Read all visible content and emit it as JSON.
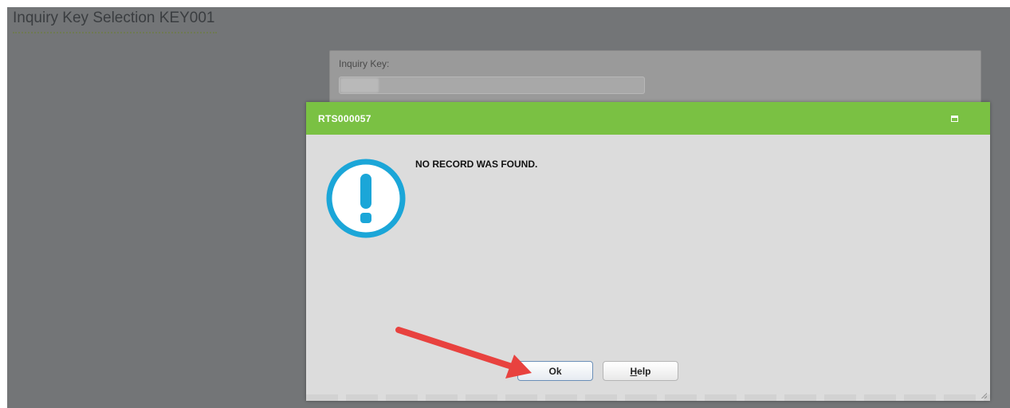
{
  "page": {
    "title": "Inquiry Key Selection KEY001"
  },
  "form": {
    "inquiry_key_label": "Inquiry Key:",
    "inquiry_key_value": ""
  },
  "dialog": {
    "title": "RTS000057",
    "message": "NO RECORD WAS FOUND.",
    "ok_label": "Ok",
    "help_mnemonic": "H",
    "help_rest": "elp"
  },
  "icons": {
    "alert": "exclamation-circle-icon",
    "maximize": "maximize-icon",
    "resize": "resize-grip-icon",
    "annotation": "red-arrow-annotation"
  },
  "colors": {
    "header_green": "#7ac143",
    "alert_blue": "#1ba6d8",
    "annotation_red": "#e8423f",
    "backdrop": "#737577"
  }
}
